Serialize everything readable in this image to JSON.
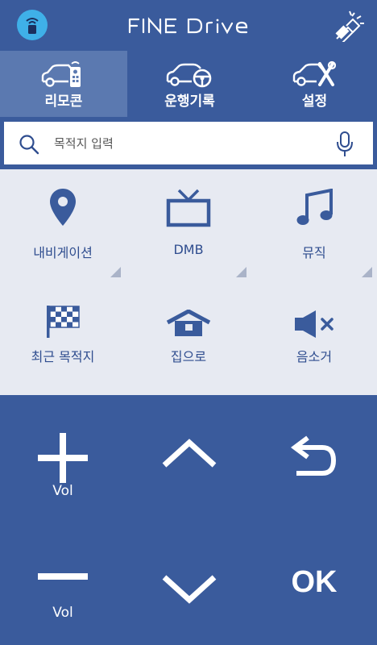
{
  "header": {
    "logo_text": "FINE Drive",
    "app_icon": "remote-app-icon",
    "flashlight_icon": "flashlight-icon"
  },
  "tabs": [
    {
      "label": "리모콘",
      "icon": "car-remote-icon",
      "active": true
    },
    {
      "label": "운행기록",
      "icon": "car-steering-icon",
      "active": false
    },
    {
      "label": "설정",
      "icon": "car-tools-icon",
      "active": false
    }
  ],
  "search": {
    "placeholder": "목적지 입력",
    "icon": "search-icon",
    "voice_icon": "microphone-icon"
  },
  "menu": [
    {
      "label": "내비게이션",
      "icon": "location-pin-icon"
    },
    {
      "label": "DMB",
      "icon": "tv-icon"
    },
    {
      "label": "뮤직",
      "icon": "music-note-icon"
    },
    {
      "label": "최근 목적지",
      "icon": "checkered-flag-icon"
    },
    {
      "label": "집으로",
      "icon": "home-icon"
    },
    {
      "label": "음소거",
      "icon": "mute-icon"
    }
  ],
  "remote": {
    "vol_up_label": "Vol",
    "vol_down_label": "Vol",
    "ok_label": "OK"
  },
  "colors": {
    "primary": "#3a5b9c",
    "active_tab": "#5b79b0",
    "menu_bg": "#e7eaf2",
    "accent": "#3fb0e8",
    "icon_blue": "#2f4d8f"
  }
}
